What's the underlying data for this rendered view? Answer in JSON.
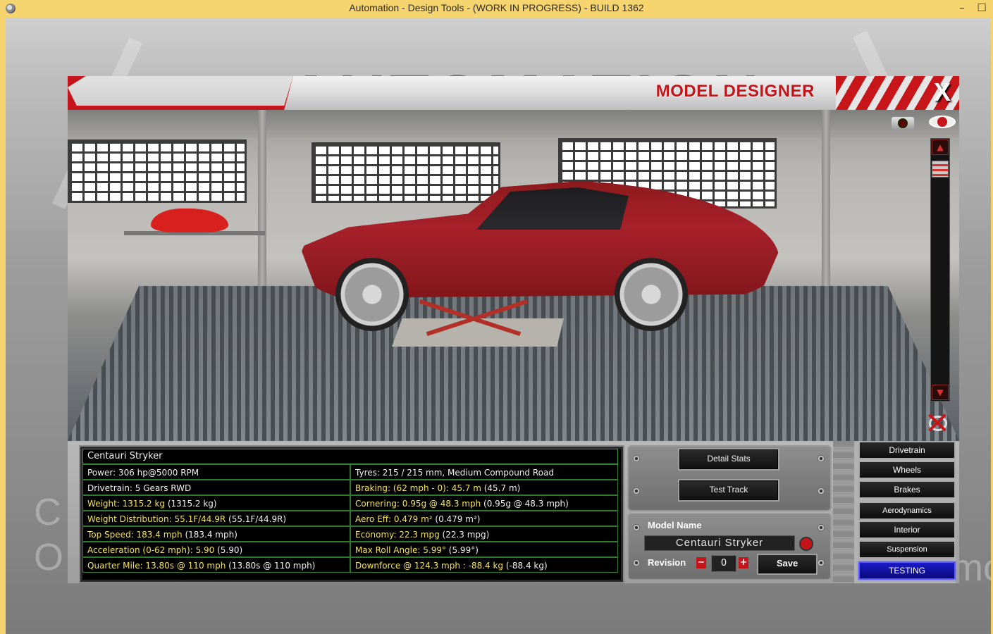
{
  "window": {
    "title": "Automation - Design Tools - (WORK IN PROGRESS) - BUILD 1362",
    "minimize_glyph": "–",
    "maximize_glyph": "☐"
  },
  "backdrop": {
    "logo_word": "AUTOMATION",
    "left_letters": "C\nO",
    "right_letters": "mo"
  },
  "dialog": {
    "title": "MODEL DESIGNER",
    "close_label": "X"
  },
  "viewport": {
    "icons": [
      "camera-icon",
      "eye-icon",
      "zoom-up-icon",
      "zoom-down-icon",
      "reset-view-icon"
    ],
    "zoom_up_glyph": "▲",
    "zoom_down_glyph": "▼",
    "zoom_level": 0.1
  },
  "stats": {
    "model_name": "Centauri Stryker",
    "rows": [
      {
        "left": "Power: 306 hp@5000 RPM",
        "right": "Tyres: 215 / 215 mm, Medium Compound Road"
      },
      {
        "left": "Drivetrain: 5 Gears RWD",
        "right_a": "Braking: (62 mph - 0): 45.7 m",
        "right_b": " (45.7 m)"
      },
      {
        "left_a": "Weight: 1315.2 kg",
        "left_b": " (1315.2 kg)",
        "right_a": "Cornering: 0.95g @ 48.3 mph",
        "right_b": " (0.95g @ 48.3 mph)"
      },
      {
        "left_a": "Weight Distribution: 55.1F/44.9R",
        "left_b": " (55.1F/44.9R)",
        "right_a": "Aero Eff: 0.479 m²",
        "right_b": " (0.479 m²)"
      },
      {
        "left_a": "Top Speed: 183.4 mph",
        "left_b": " (183.4 mph)",
        "right_a": "Economy: 22.3 mpg",
        "right_b": " (22.3 mpg)"
      },
      {
        "left_a": "Acceleration (0-62 mph): 5.90",
        "left_b": " (5.90)",
        "right_a": "Max Roll Angle: 5.99°",
        "right_b": " (5.99°)"
      },
      {
        "left_a": "Quarter Mile: 13.80s @ 110 mph",
        "left_b": " (13.80s @ 110 mph)",
        "right_a": "Downforce @ 124.3 mph : -88.4 kg",
        "right_b": " (-88.4 kg)"
      }
    ]
  },
  "actions": {
    "detail_stats_label": "Detail Stats",
    "test_track_label": "Test Track",
    "model_name_label": "Model Name",
    "model_name_value": "Centauri Stryker",
    "revision_label": "Revision",
    "revision_value": "0",
    "minus_glyph": "−",
    "plus_glyph": "+",
    "save_label": "Save"
  },
  "tabs": [
    {
      "label": "Drivetrain"
    },
    {
      "label": "Wheels"
    },
    {
      "label": "Brakes"
    },
    {
      "label": "Aerodynamics"
    },
    {
      "label": "Interior"
    },
    {
      "label": "Suspension"
    },
    {
      "label": "TESTING",
      "active": true
    }
  ],
  "colors": {
    "accent_red": "#c5151a",
    "stat_highlight": "#f2e15a",
    "grid_green": "#2f7a2f",
    "active_tab_blue": "#1a1ac8",
    "titlebar": "#f6d46e"
  }
}
